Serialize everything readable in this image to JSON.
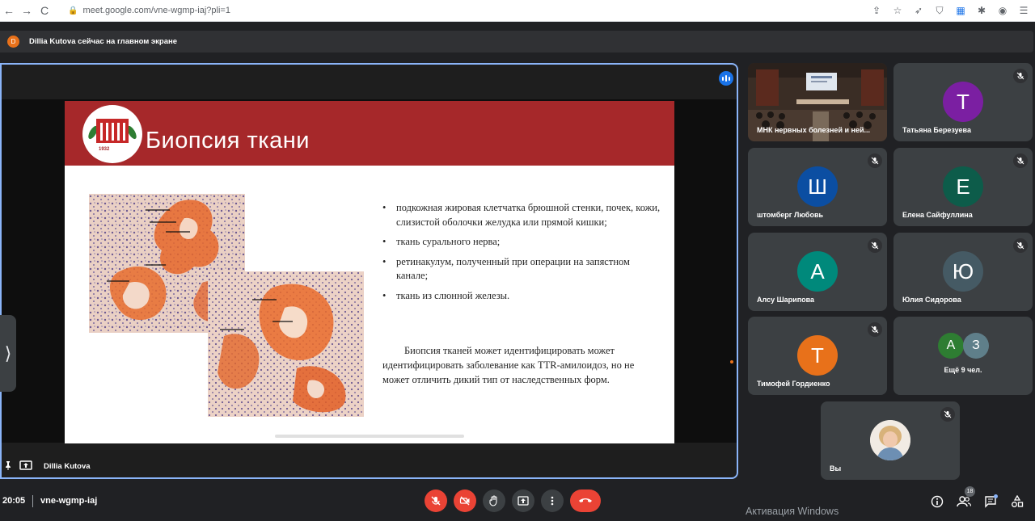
{
  "browser": {
    "url": "meet.google.com/vne-wgmp-iaj?pli=1",
    "nav": [
      "←",
      "→",
      "C"
    ]
  },
  "banner": {
    "avatar_letter": "D",
    "text": "Dillia Kutova сейчас на главном экране"
  },
  "presentation": {
    "presenter_label": "Dillia Kutova",
    "slide": {
      "title": "Биопсия ткани",
      "seal_year": "1932",
      "bullets": [
        "подкожная жировая клетчатка брюшной стенки, почек, кожи, слизистой оболочки желудка или прямой кишки;",
        "ткань сурального нерва;",
        "ретинакулум, полученный при операции на запястном канале;",
        "ткань из слюнной железы."
      ],
      "paragraph": "Биопсия тканей может идентифицировать может идентифицировать заболевание как TTR-амилоидоз, но не может отличить дикий тип от наследственных форм."
    }
  },
  "participants": [
    {
      "name": "МНК нервных болезней и ней...",
      "type": "video"
    },
    {
      "name": "Татьяна Березуева",
      "letter": "Т",
      "color": "#7b1fa2"
    },
    {
      "name": "штомберг Любовь",
      "letter": "Ш",
      "color": "#0b4ea2"
    },
    {
      "name": "Елена Сайфуллина",
      "letter": "Е",
      "color": "#0d5c4a"
    },
    {
      "name": "Алсу Шарипова",
      "letter": "А",
      "color": "#00897b"
    },
    {
      "name": "Юлия Сидорова",
      "letter": "Ю",
      "color": "#455a64"
    },
    {
      "name": "Тимофей Гордиенко",
      "letter": "Т",
      "color": "#e8711a"
    },
    {
      "name": "Ещё 9 чел.",
      "letters": [
        "А",
        "З"
      ],
      "colors": [
        "#2e7d32",
        "#5f7f8a"
      ]
    },
    {
      "name": "Вы",
      "type": "photo"
    }
  ],
  "bottom": {
    "time": "20:05",
    "meeting_code": "vne-wgmp-iaj",
    "people_count": "18",
    "activation": "Активация Windows"
  },
  "colors": {
    "accent": "#8ab4f8",
    "danger": "#ea4335",
    "slide_header": "#a6282a"
  }
}
